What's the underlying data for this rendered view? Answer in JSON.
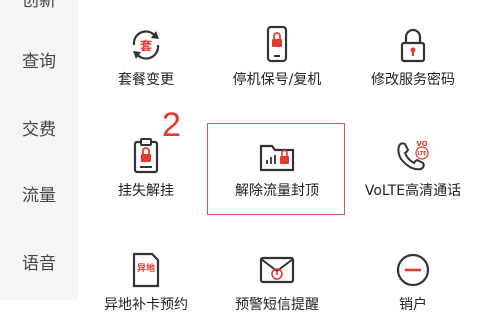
{
  "sidebar": {
    "items": [
      {
        "label": "创新"
      },
      {
        "label": "查询"
      },
      {
        "label": "交费"
      },
      {
        "label": "流量"
      },
      {
        "label": "语音"
      }
    ]
  },
  "grid": {
    "items": [
      {
        "label": "套餐变更",
        "icon": "package-change-icon",
        "icon_text": "套"
      },
      {
        "label": "停机保号/复机",
        "icon": "phone-lock-icon"
      },
      {
        "label": "修改服务密码",
        "icon": "padlock-icon"
      },
      {
        "label": "挂失解挂",
        "icon": "clipboard-lock-icon"
      },
      {
        "label": "解除流量封顶",
        "icon": "folder-lock-icon"
      },
      {
        "label": "VoLTE高清通话",
        "icon": "volte-phone-icon",
        "icon_text": "VO\nLTE"
      },
      {
        "label": "异地补卡预约",
        "icon": "remote-card-icon",
        "icon_text": "异地"
      },
      {
        "label": "预警短信提醒",
        "icon": "alert-mail-icon"
      },
      {
        "label": "销户",
        "icon": "minus-circle-icon"
      }
    ]
  },
  "annotation": {
    "step_number": "2"
  },
  "colors": {
    "accent": "#e23b2e",
    "icon_stroke": "#333333",
    "highlight_border": "#d9534f",
    "sidebar_bg": "#f5f5f5"
  }
}
